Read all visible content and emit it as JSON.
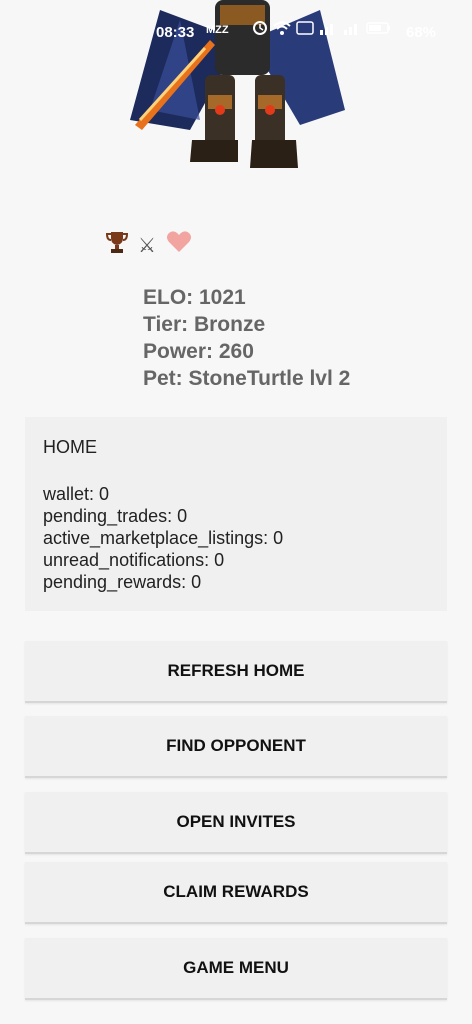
{
  "status_bar": {
    "time": "08:33",
    "notif_text": "MZZ",
    "battery": "68%"
  },
  "profile": {
    "icons": [
      "trophy-icon",
      "crossed-swords-icon",
      "heart-icon"
    ],
    "elo": "ELO: 1021",
    "tier": "Tier: Bronze",
    "power": "Power: 260",
    "pet": "Pet: StoneTurtle lvl 2"
  },
  "home": {
    "title": "HOME",
    "rows": [
      "wallet: 0",
      "pending_trades: 0",
      "active_marketplace_listings: 0",
      "unread_notifications: 0",
      "pending_rewards: 0"
    ]
  },
  "buttons": {
    "refresh_home": "REFRESH HOME",
    "find_opponent": "FIND OPPONENT",
    "open_invites": "OPEN INVITES",
    "claim_rewards": "CLAIM REWARDS",
    "game_menu": "GAME MENU"
  }
}
